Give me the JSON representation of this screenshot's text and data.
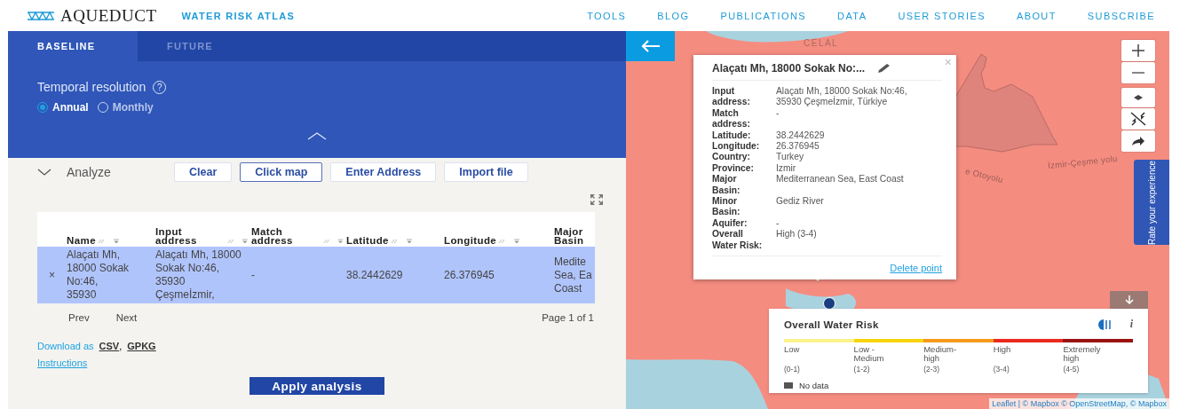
{
  "header": {
    "logo": "AQUEDUCT",
    "subtitle": "WATER RISK ATLAS",
    "nav": [
      "TOOLS",
      "BLOG",
      "PUBLICATIONS",
      "DATA",
      "USER STORIES",
      "ABOUT",
      "SUBSCRIBE"
    ]
  },
  "tabs": [
    {
      "label": "BASELINE",
      "selected": true
    },
    {
      "label": "FUTURE",
      "selected": false
    }
  ],
  "temporal_resolution": {
    "label": "Temporal resolution",
    "help": "?",
    "options": [
      {
        "label": "Annual",
        "selected": true
      },
      {
        "label": "Monthly",
        "selected": false
      }
    ]
  },
  "analyze": {
    "title": "Analyze",
    "buttons": [
      {
        "label": "Clear",
        "selected": false
      },
      {
        "label": "Click map",
        "selected": true
      },
      {
        "label": "Enter Address",
        "selected": false
      },
      {
        "label": "Import file",
        "selected": false
      }
    ]
  },
  "table": {
    "columns": [
      "Name",
      "Input address",
      "Match address",
      "Latitude",
      "Longitude",
      "Major Basin"
    ],
    "rows": [
      {
        "selected": true,
        "remove": "×",
        "cells": [
          "Alaçatı Mh, 18000 Sokak No:46, 35930",
          "Alaçatı Mh, 18000 Sokak No:46, 35930 Çeşmeİzmir,",
          "-",
          "38.2442629",
          "26.376945",
          "Medite Sea, Ea Coast"
        ]
      }
    ]
  },
  "pagination": {
    "prev": "Prev",
    "next": "Next",
    "page": "Page 1 of 1"
  },
  "download": {
    "label": "Download as",
    "links": [
      "CSV",
      "GPKG"
    ],
    "separator": ","
  },
  "instructions": "Instructions",
  "apply": "Apply analysis",
  "map": {
    "labels": [
      {
        "text": "CELAL",
        "kind": "district"
      },
      {
        "text": "e Otoyolu",
        "kind": "road"
      },
      {
        "text": "İzmir-Çeşme yolu",
        "kind": "road"
      }
    ],
    "popup": {
      "title": "Alaçatı Mh, 18000 Sokak No:...",
      "close": "×",
      "fields": [
        {
          "label": "Input address:",
          "value": "Alaçatı Mh, 18000 Sokak No:46, 35930 Çeşmeİzmir, Türkiye"
        },
        {
          "label": "Match address:",
          "value": "-"
        },
        {
          "label": "Latitude:",
          "value": "38.2442629"
        },
        {
          "label": "Longitude:",
          "value": "26.376945"
        },
        {
          "label": "Country:",
          "value": "Turkey"
        },
        {
          "label": "Province:",
          "value": "Izmir"
        },
        {
          "label": "Major Basin:",
          "value": "Mediterranean Sea, East Coast"
        },
        {
          "label": "Minor Basin:",
          "value": "Gediz River"
        },
        {
          "label": "Aquifer:",
          "value": "-"
        },
        {
          "label": "Overall Water Risk:",
          "value": "High (3-4)"
        }
      ],
      "delete": "Delete point"
    },
    "legend": {
      "title": "Overall Water Risk",
      "info": "i",
      "classes": [
        {
          "label": "Low",
          "range": "(0-1)",
          "color": "#fbf38c"
        },
        {
          "label": "Low - Medium",
          "range": "(1-2)",
          "color": "#f8d40c"
        },
        {
          "label": "Medium-high",
          "range": "(2-3)",
          "color": "#f59a1c"
        },
        {
          "label": "High",
          "range": "(3-4)",
          "color": "#ea2a1e"
        },
        {
          "label": "Extremely high",
          "range": "(4-5)",
          "color": "#9b1212"
        }
      ],
      "no_data": "No data"
    },
    "feedback": "Rate your experience",
    "attribution": "Leaflet | © Mapbox © OpenStreetMap, © Mapbox"
  }
}
